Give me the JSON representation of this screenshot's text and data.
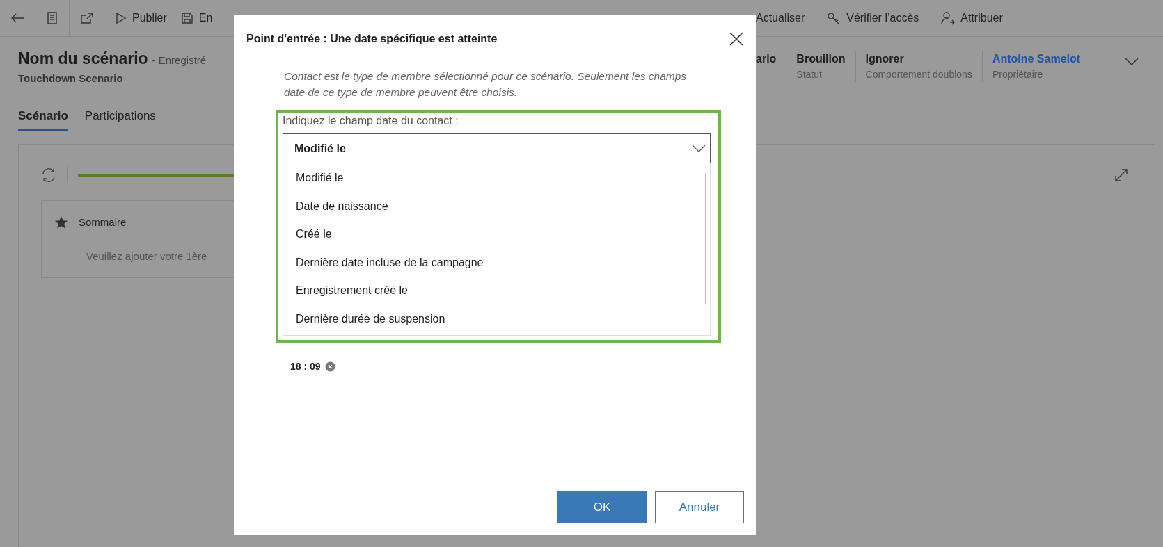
{
  "toolbar": {
    "left_items": [
      {
        "kind": "play",
        "label": "Publier"
      },
      {
        "kind": "save",
        "label": "En"
      }
    ],
    "right_items": [
      {
        "kind": "none",
        "label": "Actualiser"
      },
      {
        "kind": "key",
        "label": "Vérifier l’accès"
      },
      {
        "kind": "person",
        "label": "Attribuer"
      }
    ]
  },
  "header": {
    "title": "Nom du scénario",
    "state": "- Enregistré",
    "subtitle": "Touchdown Scenario",
    "fields": [
      {
        "value": "ario"
      },
      {
        "value": "Brouillon",
        "label": "Statut"
      },
      {
        "value": "Ignorer",
        "label": "Comportement doublons"
      },
      {
        "value": "Antoine Samelot",
        "label": "Propriétaire",
        "kind": "link"
      }
    ]
  },
  "tabs": [
    {
      "label": "Scénario",
      "selected": true
    },
    {
      "label": "Participations",
      "selected": false
    }
  ],
  "designer": {
    "card_title": "Sommaire",
    "card_text": "Veuillez ajouter votre 1ère"
  },
  "dialog": {
    "title": "Point d'entrée : Une date spécifique est atteinte",
    "description": "Contact est le type de membre sélectionné pour ce scénario. Seulement les champs date de ce type de membre peuvent être choisis.",
    "field_label": "Indiquez le champ date du contact :",
    "select_value": "Modifié le",
    "options": [
      "Modifié le",
      "Date de naissance",
      "Créé le",
      "Dernière date incluse de la campagne",
      "Enregistrement créé le",
      "Dernière durée de suspension"
    ],
    "time": "18 : 09",
    "buttons": [
      {
        "kind": "primary",
        "label": "OK"
      },
      {
        "kind": "secondary",
        "label": "Annuler"
      }
    ]
  }
}
